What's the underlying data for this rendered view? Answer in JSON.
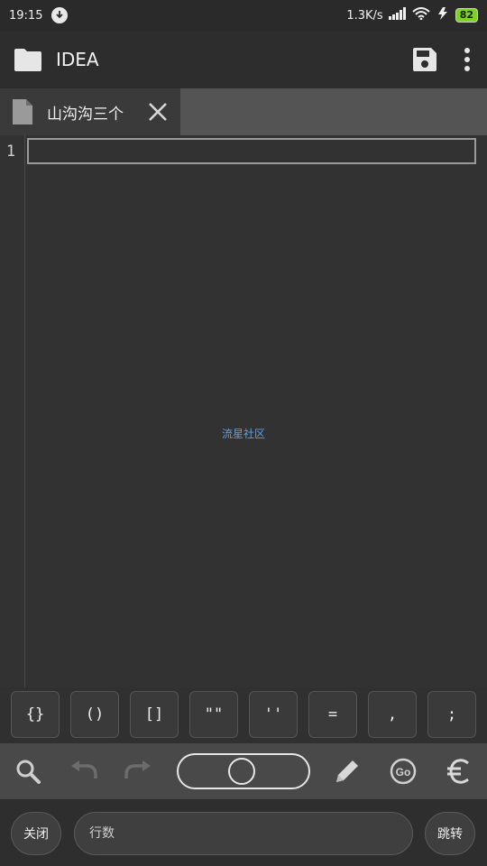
{
  "status_bar": {
    "time": "19:15",
    "network_speed": "1.3K/s",
    "battery": "82",
    "icons": [
      "download-icon",
      "signal-icon",
      "wifi-icon",
      "charging-icon"
    ]
  },
  "app_bar": {
    "title": "IDEA",
    "icons": [
      "folder-icon",
      "save-icon",
      "more-vert-icon"
    ]
  },
  "tab": {
    "label": "山沟沟三个",
    "icons": [
      "file-icon",
      "close-icon"
    ]
  },
  "editor": {
    "line_numbers": [
      "1"
    ],
    "watermark": "流星社区"
  },
  "symbol_keys": [
    "{}",
    "()",
    "[]",
    "\"\"",
    "''",
    "=",
    ",",
    ";"
  ],
  "toolbar": {
    "icons": [
      "search-icon",
      "undo-icon",
      "redo-icon",
      "toggle-switch",
      "pencil-icon",
      "go-icon",
      "euro-icon"
    ]
  },
  "bottom_bar": {
    "close_label": "关闭",
    "line_placeholder": "行数",
    "jump_label": "跳转"
  },
  "colors": {
    "background": "#303030",
    "tab_active": "#3a3a3a",
    "toolbar": "#494949",
    "watermark": "#5aa0e8",
    "battery": "#7ed321"
  }
}
